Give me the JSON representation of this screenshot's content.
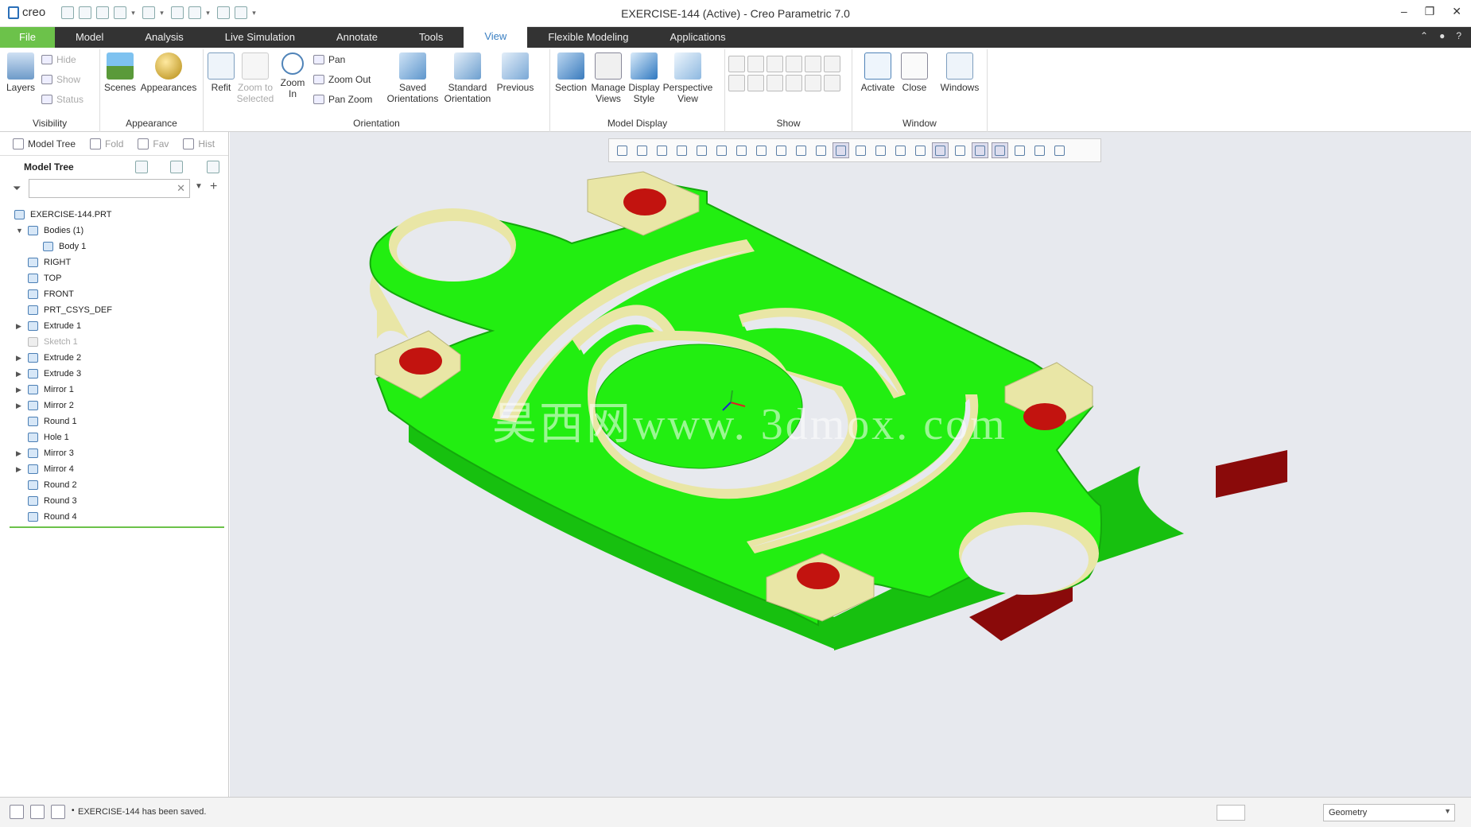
{
  "app": {
    "logo_text": "creo",
    "window_title": "EXERCISE-144 (Active) - Creo Parametric 7.0",
    "controls": [
      "–",
      "❐",
      "✕"
    ]
  },
  "tabs": [
    "File",
    "Model",
    "Analysis",
    "Live Simulation",
    "Annotate",
    "Tools",
    "View",
    "Flexible Modeling",
    "Applications"
  ],
  "active_tab": "View",
  "ribbon": {
    "visibility": {
      "label": "Visibility",
      "layers": "Layers",
      "hide": "Hide",
      "show": "Show",
      "status": "Status"
    },
    "appearance": {
      "label": "Appearance",
      "scenes": "Scenes",
      "appearances": "Appearances"
    },
    "orientation": {
      "label": "Orientation",
      "refit": "Refit",
      "zoom_selected": "Zoom to Selected",
      "zoom_in": "Zoom In",
      "pan": "Pan",
      "zoom_out": "Zoom Out",
      "pan_zoom": "Pan Zoom",
      "saved": "Saved Orientations",
      "standard": "Standard Orientation",
      "previous": "Previous"
    },
    "model_display": {
      "label": "Model Display",
      "section": "Section",
      "manage_views": "Manage Views",
      "display_style": "Display Style",
      "perspective": "Perspective View"
    },
    "show": {
      "label": "Show"
    },
    "window": {
      "label": "Window",
      "activate": "Activate",
      "close": "Close",
      "windows": "Windows"
    }
  },
  "left_panel": {
    "tabs": [
      "Model Tree",
      "Fold",
      "Fav",
      "Hist"
    ],
    "header": "Model Tree",
    "search_value": "",
    "tree": [
      {
        "label": "EXERCISE-144.PRT",
        "indent": 0,
        "expand": "",
        "disabled": false
      },
      {
        "label": "Bodies (1)",
        "indent": 1,
        "expand": "▼",
        "disabled": false
      },
      {
        "label": "Body 1",
        "indent": 2,
        "expand": "",
        "disabled": false
      },
      {
        "label": "RIGHT",
        "indent": 1,
        "expand": "",
        "disabled": false
      },
      {
        "label": "TOP",
        "indent": 1,
        "expand": "",
        "disabled": false
      },
      {
        "label": "FRONT",
        "indent": 1,
        "expand": "",
        "disabled": false
      },
      {
        "label": "PRT_CSYS_DEF",
        "indent": 1,
        "expand": "",
        "disabled": false
      },
      {
        "label": "Extrude 1",
        "indent": 1,
        "expand": "▶",
        "disabled": false
      },
      {
        "label": "Sketch 1",
        "indent": 1,
        "expand": "",
        "disabled": true
      },
      {
        "label": "Extrude 2",
        "indent": 1,
        "expand": "▶",
        "disabled": false
      },
      {
        "label": "Extrude 3",
        "indent": 1,
        "expand": "▶",
        "disabled": false
      },
      {
        "label": "Mirror 1",
        "indent": 1,
        "expand": "▶",
        "disabled": false
      },
      {
        "label": "Mirror 2",
        "indent": 1,
        "expand": "▶",
        "disabled": false
      },
      {
        "label": "Round 1",
        "indent": 1,
        "expand": "",
        "disabled": false
      },
      {
        "label": "Hole 1",
        "indent": 1,
        "expand": "",
        "disabled": false
      },
      {
        "label": "Mirror 3",
        "indent": 1,
        "expand": "▶",
        "disabled": false
      },
      {
        "label": "Mirror 4",
        "indent": 1,
        "expand": "▶",
        "disabled": false
      },
      {
        "label": "Round 2",
        "indent": 1,
        "expand": "",
        "disabled": false
      },
      {
        "label": "Round 3",
        "indent": 1,
        "expand": "",
        "disabled": false
      },
      {
        "label": "Round 4",
        "indent": 1,
        "expand": "",
        "disabled": false
      }
    ]
  },
  "viewport": {
    "watermark": "昊西网www. 3dmox. com",
    "colors": {
      "body": "#22ee11",
      "wall": "#e9e6a6",
      "hole": "#c2130f",
      "side": "#17c00f",
      "bg": "#e7e9ee"
    }
  },
  "status": {
    "message": "EXERCISE-144 has been saved.",
    "filter": "Geometry"
  }
}
